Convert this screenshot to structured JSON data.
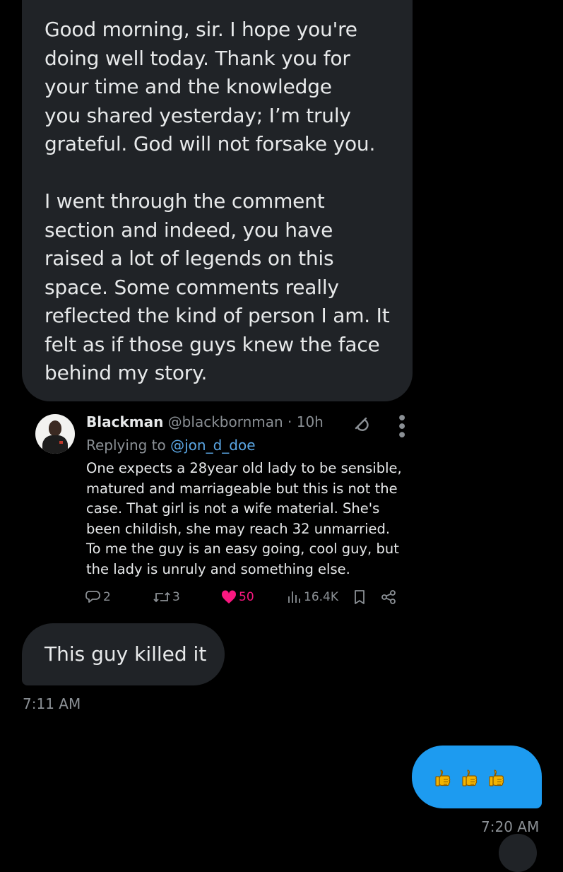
{
  "messages": {
    "first": {
      "text": "Good morning, sir. I hope you're\ndoing well today. Thank you for\nyour time and the knowledge\nyou shared yesterday; I’m truly\ngrateful. God will not forsake you.\n\nI went through the comment\nsection and indeed, you have\nraised a lot of legends on this\nspace. Some comments really\nreflected the kind of person I am. It\nfelt as if those guys knew the face\nbehind my story."
    },
    "second": {
      "text": "This guy killed it",
      "time": "7:11 AM"
    },
    "reply": {
      "emoji_count": 3,
      "time": "7:20 AM"
    }
  },
  "tweet": {
    "name": "Blackman",
    "handle_time": " @blackbornman · 10h",
    "replying_prefix": "Replying to ",
    "replying_to": "@jon_d_doe",
    "text": "One expects a 28year old lady to be sensible,\nmatured and marriageable but this is not the\ncase. That girl is not a wife material. She's\nbeen childish, she may reach 32 unmarried.\nTo me the guy is an easy going, cool guy, but\nthe lady is unruly and something else.",
    "replies": "2",
    "retweets": "3",
    "likes": "50",
    "views": "16.4K"
  },
  "icons": {
    "avatar": "person-avatar",
    "grok": "grok-icon",
    "more": "more-icon",
    "reply": "reply-icon",
    "retweet": "retweet-icon",
    "like": "heart-icon",
    "views": "views-icon",
    "bookmark": "bookmark-icon",
    "share": "share-icon",
    "thumbs": "thumbs-up-icon"
  },
  "colors": {
    "background": "#000000",
    "incoming_bubble": "#202327",
    "outgoing_bubble": "#1d9bf0",
    "like": "#f91880",
    "mention": "#5ba7e5",
    "muted": "#8b9095"
  }
}
